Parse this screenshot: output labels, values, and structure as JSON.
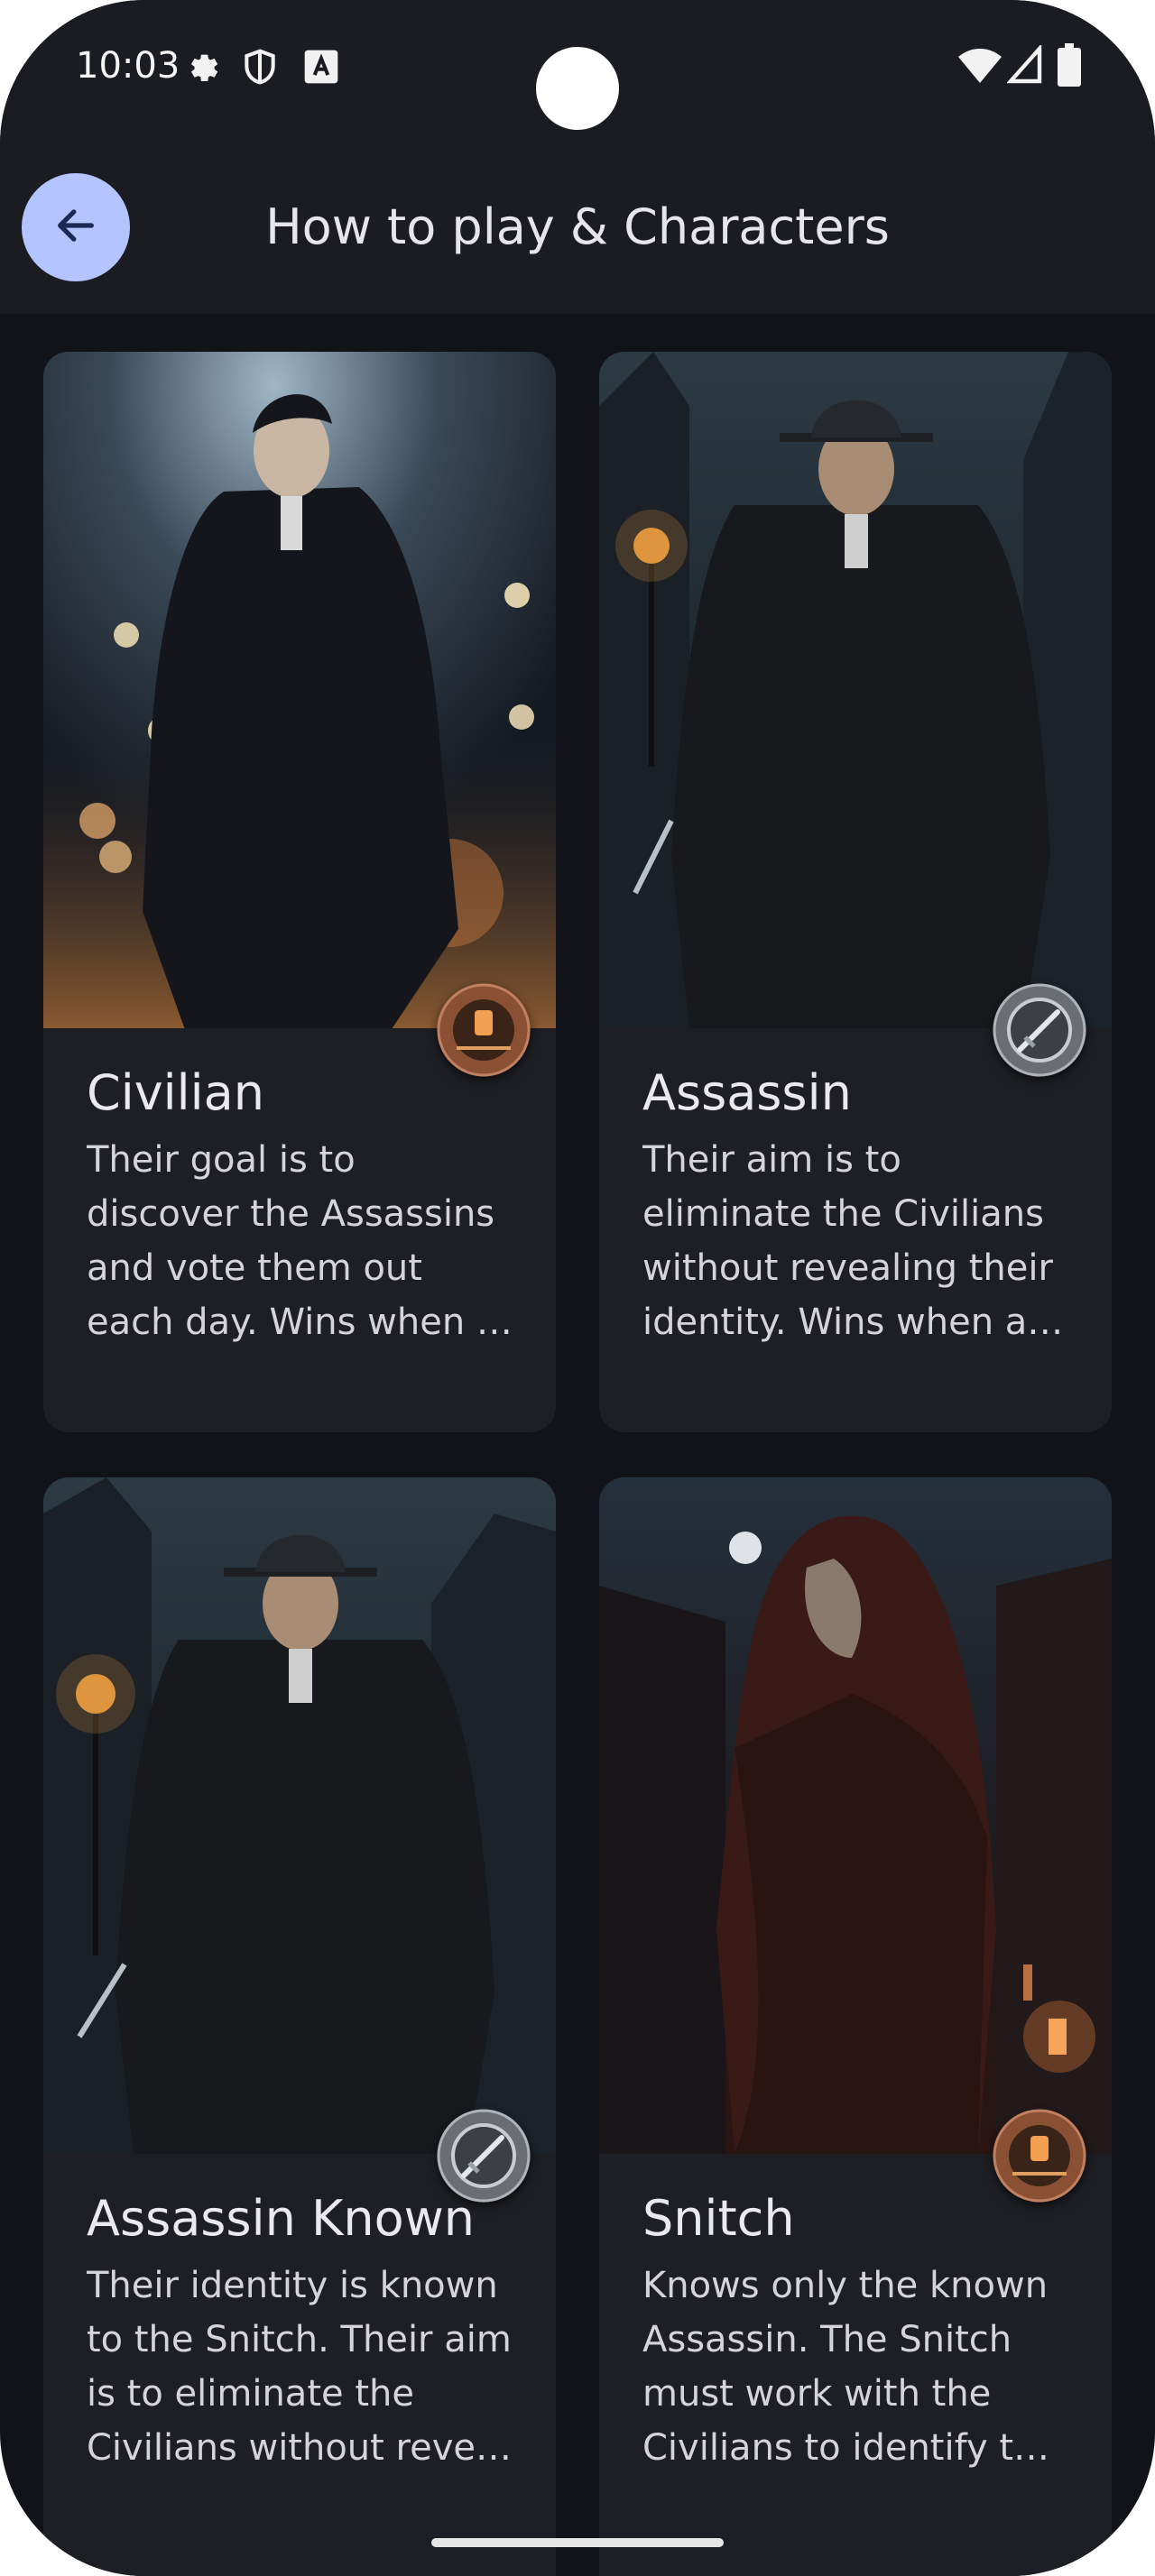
{
  "status_bar": {
    "time": "10:03",
    "left_icons": [
      "gear-icon",
      "shield-icon",
      "a-icon"
    ],
    "right_icons": [
      "wifi-icon",
      "signal-icon",
      "battery-icon"
    ]
  },
  "app_bar": {
    "title": "How to play & Characters",
    "back_icon": "arrow-left-icon",
    "back_button_color": "#b3c4ff"
  },
  "cards": [
    {
      "title": "Civilian",
      "description": "Their goal is to discover the Assassins and vote them out each day. Wins when …",
      "badge": "lantern-badge"
    },
    {
      "title": "Assassin",
      "description": "Their aim is to eliminate the Civilians without revealing their identity. Wins when a…",
      "badge": "dagger-badge"
    },
    {
      "title": "Assassin Known",
      "description": "Their identity is known to the Snitch. Their aim is to eliminate the Civilians without reve…",
      "badge": "dagger-badge"
    },
    {
      "title": "Snitch",
      "description": "Knows only the known Assassin. The Snitch must work with the Civilians to identify t…",
      "badge": "lantern-badge"
    }
  ],
  "colors": {
    "background": "#111318",
    "app_bar": "#1b1c21",
    "card": "#1e1f24"
  }
}
